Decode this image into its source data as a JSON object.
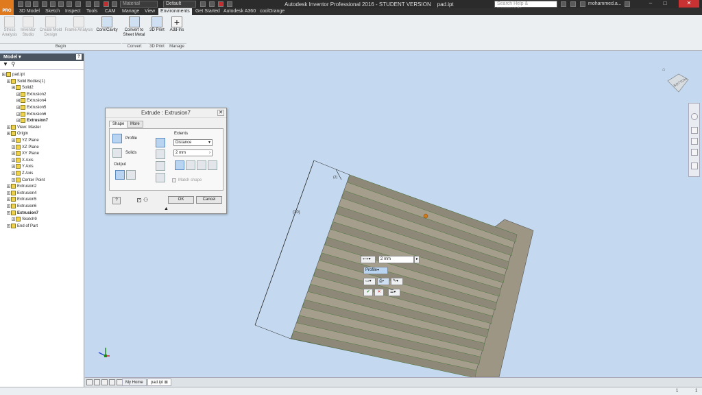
{
  "app": {
    "title": "Autodesk Inventor Professional 2016 - STUDENT VERSION",
    "document": "pad.ipt",
    "logo": "PRO"
  },
  "quick_access": {
    "material_placeholder": "Material",
    "appearance": "Default",
    "search_placeholder": "Search Help & Commands...",
    "user": "mohammed.a..."
  },
  "menu": [
    "3D Model",
    "Sketch",
    "Inspect",
    "Tools",
    "CAM",
    "Manage",
    "View",
    "Environments",
    "Get Started",
    "Autodesk A360",
    "coolOrange"
  ],
  "ribbon": {
    "buttons": [
      {
        "label": "Stress Analysis",
        "disabled": true
      },
      {
        "label": "Inventor Studio",
        "disabled": true
      },
      {
        "label": "Create Mold Design",
        "disabled": true
      },
      {
        "label": "Frame Analysis",
        "disabled": true
      },
      {
        "label": "Core/Cavity",
        "disabled": false
      },
      {
        "label": "Convert to Sheet Metal",
        "disabled": false
      },
      {
        "label": "3D Print",
        "disabled": false
      },
      {
        "label": "Add-Ins",
        "disabled": false
      }
    ],
    "panels": [
      "Begin",
      "Convert",
      "3D Print",
      "Manage"
    ]
  },
  "browser": {
    "title": "Model",
    "nodes": [
      {
        "label": "pad.ipt",
        "level": 0
      },
      {
        "label": "Solid Bodies(1)",
        "level": 1
      },
      {
        "label": "Solid2",
        "level": 2
      },
      {
        "label": "Extrusion2",
        "level": 3
      },
      {
        "label": "Extrusion4",
        "level": 3
      },
      {
        "label": "Extrusion5",
        "level": 3
      },
      {
        "label": "Extrusion6",
        "level": 3
      },
      {
        "label": "Extrusion7",
        "level": 3,
        "bold": true
      },
      {
        "label": "View: Master",
        "level": 1
      },
      {
        "label": "Origin",
        "level": 1
      },
      {
        "label": "YZ Plane",
        "level": 2
      },
      {
        "label": "XZ Plane",
        "level": 2
      },
      {
        "label": "XY Plane",
        "level": 2
      },
      {
        "label": "X Axis",
        "level": 2
      },
      {
        "label": "Y Axis",
        "level": 2
      },
      {
        "label": "Z Axis",
        "level": 2
      },
      {
        "label": "Center Point",
        "level": 2
      },
      {
        "label": "Extrusion2",
        "level": 1
      },
      {
        "label": "Extrusion4",
        "level": 1
      },
      {
        "label": "Extrusion5",
        "level": 1
      },
      {
        "label": "Extrusion6",
        "level": 1
      },
      {
        "label": "Extrusion7",
        "level": 1,
        "bold": true
      },
      {
        "label": "Sketch9",
        "level": 2
      },
      {
        "label": "End of Part",
        "level": 1
      }
    ]
  },
  "dialog": {
    "title": "Extrude : Extrusion7",
    "tabs": [
      "Shape",
      "More"
    ],
    "profile_label": "Profile",
    "solids_label": "Solids",
    "output_label": "Output",
    "extents_label": "Extents",
    "extents_type": "Distance",
    "distance": "2 mm",
    "match_shape": "Match shape",
    "ok": "OK",
    "cancel": "Cancel",
    "help": "?"
  },
  "viewport": {
    "dim_large": "(30)",
    "dim_small": "(2)",
    "mini_distance": "2 mm",
    "mini_profile": "Profile",
    "viewcube_label": "BOTTOM"
  },
  "doc_tabs": [
    "My Home",
    "pad.ipt"
  ],
  "status": {
    "left": "",
    "right_a": "1",
    "right_b": "1"
  },
  "colors": {
    "accent": "#e07a1f",
    "part_face": "#a29a8a",
    "part_edge": "#4a7a3a",
    "viewport_bg": "#c4d9ef"
  }
}
